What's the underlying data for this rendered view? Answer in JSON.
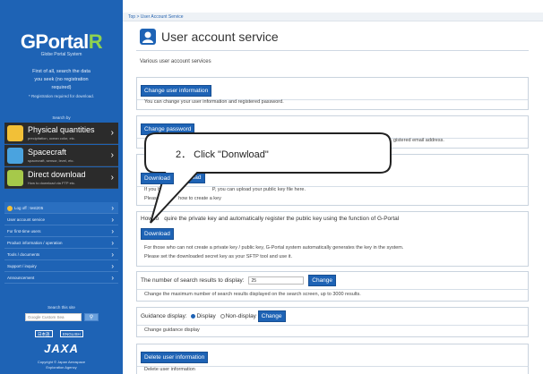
{
  "sidebar": {
    "logo_main": "GPortal",
    "logo_r": "R",
    "logo_sub": "Globe Portal System",
    "intro_line1": "First of all, search the data",
    "intro_line2": "you seek (no registration",
    "intro_line3": "required)",
    "intro_note": "* Registration required for download.",
    "search_by": "Search by",
    "big_buttons": [
      {
        "title": "Physical quantities",
        "sub": "precipitation, ocean color, etc.",
        "icon": "sun-icon",
        "color": "#f2c037"
      },
      {
        "title": "Spacecraft",
        "sub": "spacecraft, sensor, level, etc.",
        "icon": "satellite-icon",
        "color": "#4aa3df"
      },
      {
        "title": "Direct download",
        "sub": "How to download via FTP etc.",
        "icon": "monitor-icon",
        "color": "#a6c94a"
      }
    ],
    "nav": [
      {
        "label": "Log off : test205"
      },
      {
        "label": "User account service"
      },
      {
        "label": "For first-time users"
      },
      {
        "label": "Product information / operation"
      },
      {
        "label": "Tools / documents"
      },
      {
        "label": "Support / inquiry"
      },
      {
        "label": "Announcement"
      }
    ],
    "search_site": "Search this site",
    "search_placeholder": "Google Custom Sea",
    "lang_ja": "日本語",
    "lang_en": "ENGLISH",
    "agency_logo": "JAXA",
    "copyright_1": "Copyright © Japan Aerospace",
    "copyright_2": "Exploration Agency"
  },
  "breadcrumb": "Top > User Account Service",
  "page": {
    "title": "User account service",
    "intro": "Various user account services"
  },
  "sections": {
    "change_info": {
      "button": "Change user information",
      "desc": "You can change your user information and registered password."
    },
    "change_password": {
      "button": "Change password",
      "desc_tail": "gistered email address."
    },
    "keys": {
      "btn_a": "Download",
      "btn_b": "Upload",
      "desc1_head": "If you hav",
      "desc1_tail": "P, you can upload your public key file here.",
      "desc2_head": "Please se",
      "desc2_tail": "how to create a key"
    },
    "acquire": {
      "head_pre": "How to",
      "head_post": "quire the private key and automatically register the public key using the function of G-Portal",
      "button": "Download",
      "desc1": "For those who can not create a private key / public key, G-Portal system automatically generates the key in the system.",
      "desc2": "Please set the downloaded secret key as your SFTP tool and use it."
    },
    "results": {
      "label": "The number of search results to display:",
      "value": "25",
      "button": "Change",
      "desc": "Change the maximum number of search results displayed on the search screen, up to 3000 results."
    },
    "guidance": {
      "label": "Guidance display:",
      "opt_display": "Display",
      "opt_nondisplay": "Non-display",
      "button": "Change",
      "desc": "Change guidance display"
    },
    "delete": {
      "button": "Delete user information",
      "desc": "Delete user information"
    }
  },
  "callout": {
    "text": "2． Click \"Donwload\""
  }
}
